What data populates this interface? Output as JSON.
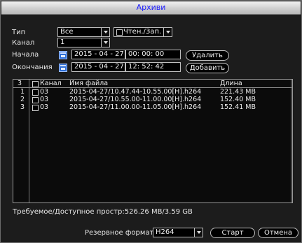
{
  "window": {
    "title": "Архиви"
  },
  "form": {
    "type_label": "Тип",
    "type_value": "Все",
    "mode_value": "Чтен./Зап.",
    "channel_label": "Канал",
    "channel_value": "1",
    "start_label": "Начала",
    "start_date": "2015 - 04 - 27",
    "start_time": "00: 00: 00",
    "end_label": "Окончания",
    "end_date": "2015 - 04 - 27",
    "end_time": "12: 52: 42",
    "delete_button": "Удалить",
    "add_button": "Добавить"
  },
  "table": {
    "count": "3",
    "headers": {
      "channel": "Канал",
      "filename": "Имя файла",
      "length": "Длина"
    },
    "rows": [
      {
        "index": "1",
        "channel": "03",
        "filename": "2015-04-27/10.47.44-10.55.00[H].h264",
        "length": "221.43 MB"
      },
      {
        "index": "2",
        "channel": "03",
        "filename": "2015-04-27/10.55.00-11.00.00[H].h264",
        "length": "152.40 MB"
      },
      {
        "index": "3",
        "channel": "03",
        "filename": "2015-04-27/11.00.00-11.05.00[H].h264",
        "length": "152.41 MB"
      }
    ]
  },
  "status": {
    "space": "Требуемое/Доступное простр:526.26 MB/3.59 GB"
  },
  "footer": {
    "format_label": "Резервное формата",
    "format_value": "H264",
    "start_button": "Старт",
    "cancel_button": "Отмена"
  }
}
